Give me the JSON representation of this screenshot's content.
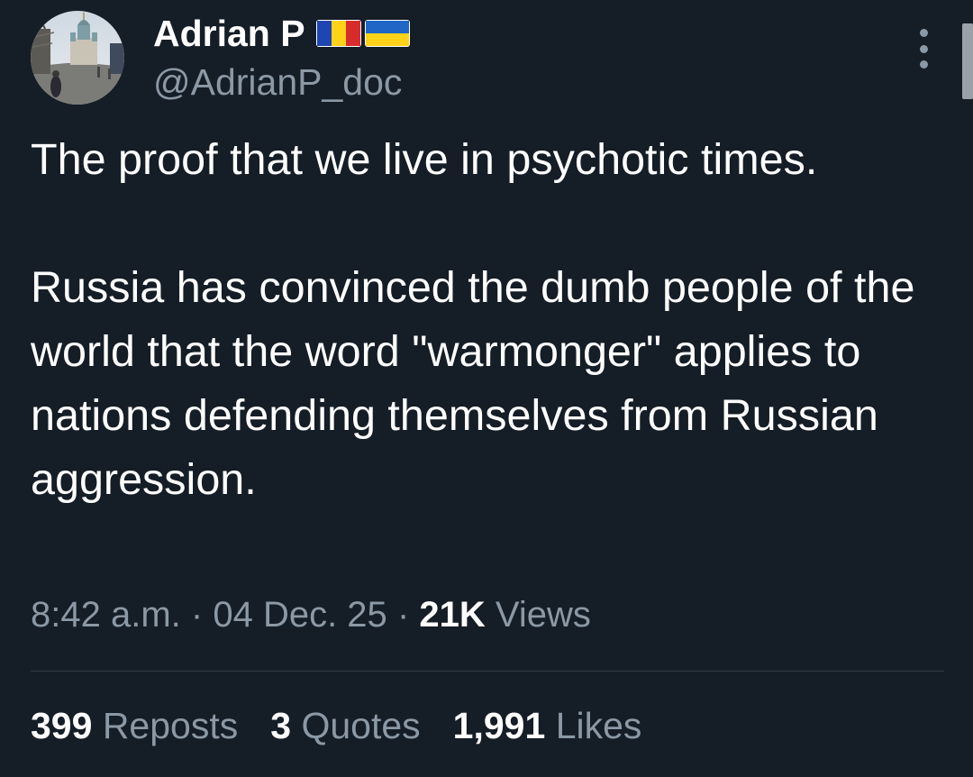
{
  "user": {
    "display_name": "Adrian P",
    "handle": "@AdrianP_doc",
    "flags": [
      "flag-romania-icon",
      "flag-ukraine-icon"
    ]
  },
  "tweet": {
    "paragraphs": [
      "The proof that we live in psychotic times.",
      "Russia has convinced the dumb people of the world that the word \"warmonger\" applies to nations defending themselves from Russian aggression."
    ],
    "time": "8:42 a.m.",
    "separator": "·",
    "date": "04 Dec. 25",
    "views_count": "21K",
    "views_label": "Views"
  },
  "stats": {
    "reposts_count": "399",
    "reposts_label": "Reposts",
    "quotes_count": "3",
    "quotes_label": "Quotes",
    "likes_count": "1,991",
    "likes_label": "Likes"
  },
  "colors": {
    "background": "#151d26",
    "primary_text": "#ffffff",
    "secondary_text": "#8b98a5",
    "divider": "#333d47"
  }
}
